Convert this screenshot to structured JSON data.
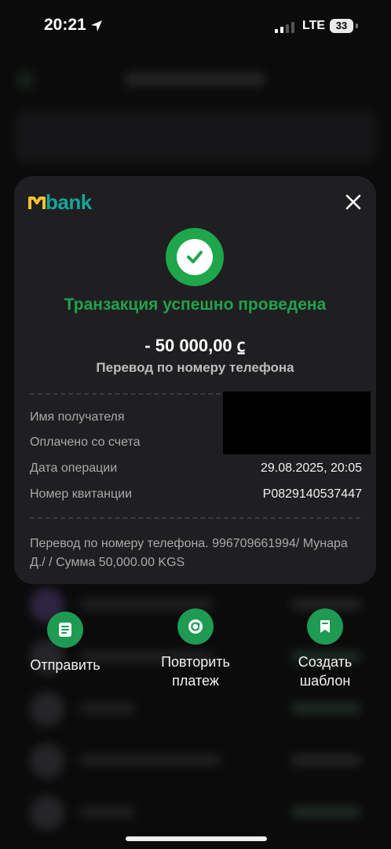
{
  "status_bar": {
    "time": "20:21",
    "network": "LTE",
    "battery": "33"
  },
  "brand": {
    "logo_text": "bank",
    "accent": "#16a59a",
    "success": "#21a24c"
  },
  "receipt": {
    "title": "Транзакция успешно проведена",
    "amount": "- 50 000,00 ⃀",
    "type": "Перевод по номеру телефона",
    "rows": [
      {
        "label": "Имя получателя",
        "value": ""
      },
      {
        "label": "Оплачено со счета",
        "value": ""
      },
      {
        "label": "Дата операции",
        "value": "29.08.2025, 20:05"
      },
      {
        "label": "Номер квитанции",
        "value": "P0829140537447"
      }
    ],
    "note": "Перевод по номеру телефона. 996709661994/ Мунара Д./  / Сумма 50,000.00 KGS"
  },
  "actions": {
    "send": {
      "label": "Отправить",
      "icon": "list-icon"
    },
    "repeat": {
      "label": "Повторить платеж",
      "icon": "repeat-icon"
    },
    "template": {
      "label": "Создать шаблон",
      "icon": "bookmark-icon"
    }
  }
}
